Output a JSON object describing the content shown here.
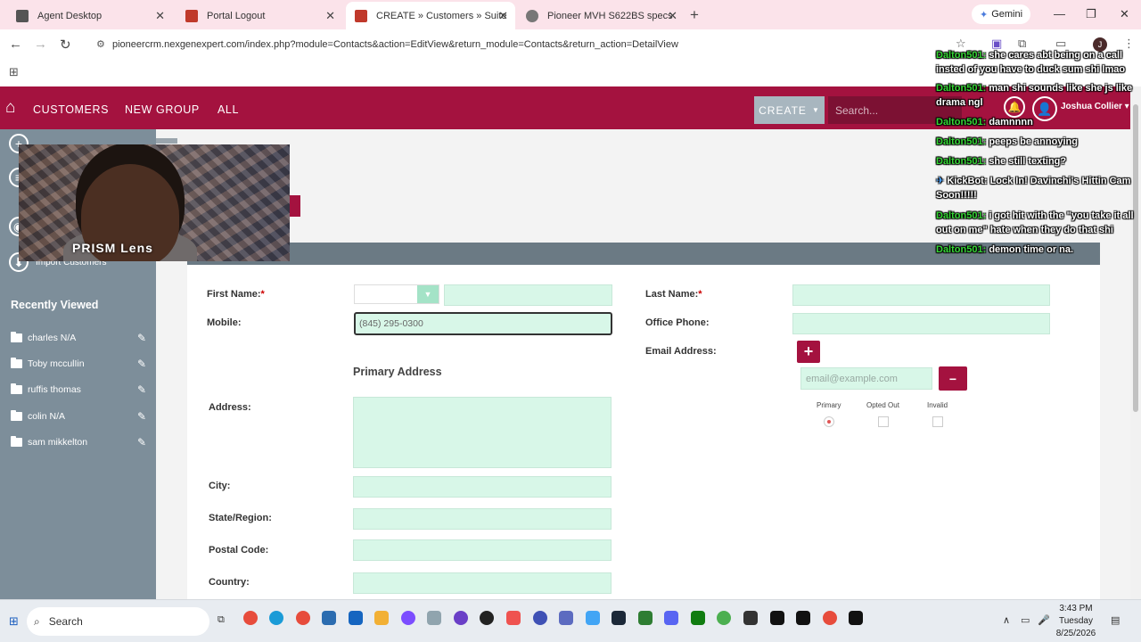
{
  "browser": {
    "tabs": [
      {
        "title": "Agent Desktop",
        "active": false,
        "icon": "grid-app-icon",
        "color": "#555555"
      },
      {
        "title": "Portal Logout",
        "active": false,
        "icon": "portal-icon",
        "color": "#c0392b"
      },
      {
        "title": "CREATE » Customers » SuiteCRM",
        "active": true,
        "icon": "suitecrm-icon",
        "color": "#c0392b"
      },
      {
        "title": "Pioneer MVH S622BS specs",
        "active": false,
        "icon": "globe-icon",
        "color": "#777777"
      }
    ],
    "gemini_label": "Gemini",
    "url": "pioneercrm.nexgenexpert.com/index.php?module=Contacts&action=EditView&return_module=Contacts&return_action=DetailView",
    "profile_initial": "J"
  },
  "crm": {
    "nav": {
      "customers": "CUSTOMERS",
      "new_group": "NEW GROUP",
      "all": "ALL"
    },
    "create_label": "CREATE",
    "search_placeholder": "Search...",
    "user_name": "Joshua Collier",
    "sidebar": {
      "import_label": "Import Customers",
      "recent_title": "Recently Viewed",
      "recent": [
        "charles N/A",
        "Toby mcculIin",
        "ruffis thomas",
        "colin N/A",
        "sam mikkelton"
      ]
    },
    "form": {
      "first_name_label": "First Name:",
      "last_name_label": "Last Name:",
      "mobile_label": "Mobile:",
      "mobile_value": "(845) 295-0300",
      "office_phone_label": "Office Phone:",
      "email_label": "Email Address:",
      "email_placeholder": "email@example.com",
      "email_headers": {
        "primary": "Primary",
        "opted_out": "Opted Out",
        "invalid": "Invalid"
      },
      "primary_address_title": "Primary Address",
      "address_label": "Address:",
      "city_label": "City:",
      "state_label": "State/Region:",
      "postal_label": "Postal Code:",
      "country_label": "Country:",
      "required_mark": "*"
    }
  },
  "webcam_overlay_text": "PRISM Lens",
  "chat": [
    {
      "user": "Dalton501:",
      "text": "she cares abt being on a call insted of you have to duck sum shi lmao",
      "kind": "user"
    },
    {
      "user": "Dalton501:",
      "text": "man shi sounds like she js like drama ngl",
      "kind": "user"
    },
    {
      "user": "Dalton501:",
      "text": "damnnnn",
      "kind": "user"
    },
    {
      "user": "Dalton501:",
      "text": "peeps be annoying",
      "kind": "user"
    },
    {
      "user": "Dalton501:",
      "text": "she still texting?",
      "kind": "user"
    },
    {
      "user": "KickBot:",
      "text": "Lock In! Davinchi's Hittin Cam Soon!!!!!",
      "kind": "bot"
    },
    {
      "user": "Dalton501:",
      "text": "i got hit with the \"you take it all out on me\" hate when they do that shi",
      "kind": "user"
    },
    {
      "user": "Dalton501:",
      "text": "demon time or na.",
      "kind": "user"
    }
  ],
  "taskbar": {
    "search_label": "Search",
    "time": "3:43 PM",
    "day": "Tuesday",
    "date": "8/25/2026"
  },
  "colors": {
    "brand": "#a4123f",
    "field_bg": "#d8f7e8",
    "sidebar": "#7d8e9a",
    "chat_user": "#35d635"
  }
}
